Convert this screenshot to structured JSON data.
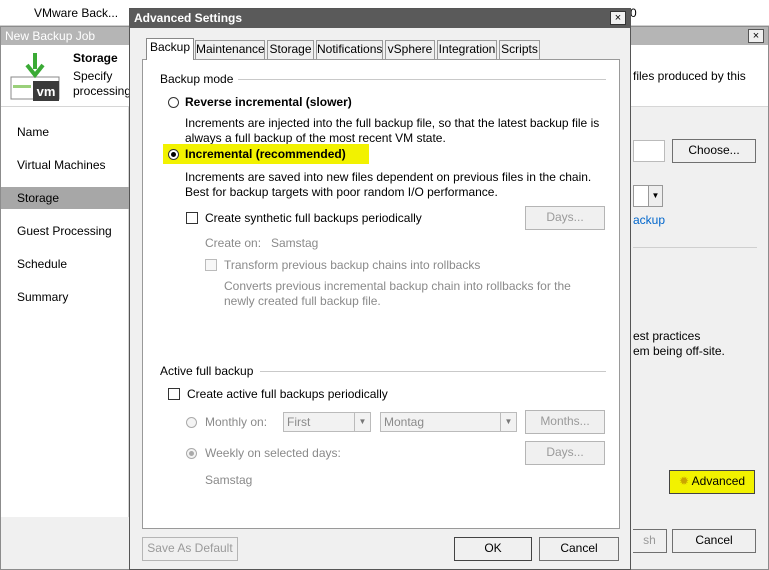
{
  "background": {
    "top_strip_item": "VMware Back...",
    "top_strip_item2": "0",
    "window_title": "New Backup Job",
    "close_glyph": "×",
    "header_title": "Storage",
    "header_desc": "Specify processing settings for this job and customize",
    "header_desc_right": "files produced by this",
    "nav": [
      "Name",
      "Virtual Machines",
      "Storage",
      "Guest Processing",
      "Schedule",
      "Summary"
    ],
    "active_nav": "Storage",
    "choose_button": "Choose...",
    "link_text": "ackup",
    "side_text_1": "est practices",
    "side_text_2": "em being off-site.",
    "advanced_button": "Advanced",
    "finish_fragment": "sh",
    "cancel_button": "Cancel"
  },
  "dialog": {
    "title": "Advanced Settings",
    "close_glyph": "×",
    "tabs": [
      "Backup",
      "Maintenance",
      "Storage",
      "Notifications",
      "vSphere",
      "Integration",
      "Scripts"
    ],
    "active_tab": "Backup",
    "backup_mode": {
      "group_label": "Backup mode",
      "reverse_label": "Reverse incremental (slower)",
      "reverse_desc_1": "Increments are injected into the full backup file, so that the latest backup file is",
      "reverse_desc_2": "always a full backup of the most recent VM state.",
      "incremental_label": "Incremental (recommended)",
      "incremental_desc_1": "Increments are saved into new files dependent on previous files in the chain.",
      "incremental_desc_2": "Best for backup targets with poor random I/O performance.",
      "synthetic_label": "Create synthetic full backups periodically",
      "synthetic_days_button": "Days...",
      "create_on_label": "Create on:",
      "create_on_value": "Samstag",
      "transform_label": "Transform previous backup chains into rollbacks",
      "transform_desc_1": "Converts previous incremental backup chain into rollbacks for the",
      "transform_desc_2": "newly created full backup file."
    },
    "active_full": {
      "group_label": "Active full backup",
      "create_label": "Create active full backups periodically",
      "monthly_label": "Monthly on:",
      "monthly_week": "First",
      "monthly_day": "Montag",
      "months_button": "Months...",
      "weekly_label": "Weekly on selected days:",
      "weekly_days_button": "Days...",
      "weekly_value": "Samstag"
    },
    "save_default_button": "Save As Default",
    "ok_button": "OK",
    "cancel_button": "Cancel"
  },
  "colors": {
    "highlight": "#f2f200",
    "dialog_title_bg": "#5a5a5a",
    "bg_title_bg": "#b5b5b5",
    "link": "#0066cc"
  }
}
